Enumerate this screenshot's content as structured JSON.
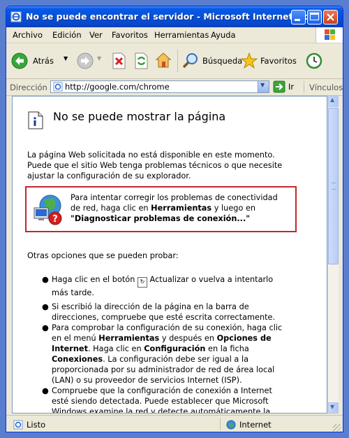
{
  "window": {
    "title": "No se puede encontrar el servidor - Microsoft Internet Ex..."
  },
  "menu": [
    "Archivo",
    "Edición",
    "Ver",
    "Favoritos",
    "Herramientas",
    "Ayuda"
  ],
  "toolbar": {
    "back": "Atrás",
    "search": "Búsqueda",
    "favorites": "Favoritos"
  },
  "address": {
    "label": "Dirección",
    "url": "http://google.com/chrome",
    "go": "Ir",
    "links": "Vínculos"
  },
  "page": {
    "heading": "No se puede mostrar la página",
    "intro": "La página Web solicitada no está disponible en este momento. Puede que el sitio Web tenga problemas técnicos o que necesite ajustar la configuración de su explorador.",
    "diag_line1": "Para intentar corregir los problemas de conectividad",
    "diag_line2a": "de red, haga clic en ",
    "diag_line2b": "Herramientas",
    "diag_line2c": " y luego en",
    "diag_line3": "\"Diagnosticar problemas de conexión...\"",
    "other": "Otras opciones que se pueden probar:",
    "b1a": "Haga clic en el botón ",
    "b1b": " Actualizar o vuelva a intentarlo",
    "b1c": "más tarde.",
    "b2": "Si escribió la dirección de la página en la barra de direcciones, compruebe que esté escrita correctamente.",
    "b3a": "Para comprobar la configuración de su conexión, haga clic en el menú ",
    "b3b": "Herramientas",
    "b3c": " y después en ",
    "b3d": "Opciones de Internet",
    "b3e": ". Haga clic en ",
    "b3f": "Configuración",
    "b3g": " en la ficha ",
    "b3h": "Conexiones",
    "b3i": ". La configuración debe ser igual a la proporcionada por su administrador de red de área local (LAN) o su proveedor de servicios Internet (ISP).",
    "b4": "Compruebe que la configuración de conexión a Internet esté siendo detectada. Puede establecer que Microsoft Windows examine la red y detecte automáticamente la"
  },
  "status": {
    "left": "Listo",
    "zone": "Internet"
  },
  "colors": {
    "titlebar": "#0550d8",
    "desktop": "#5a7ecf",
    "diag_border": "#c0282d"
  }
}
